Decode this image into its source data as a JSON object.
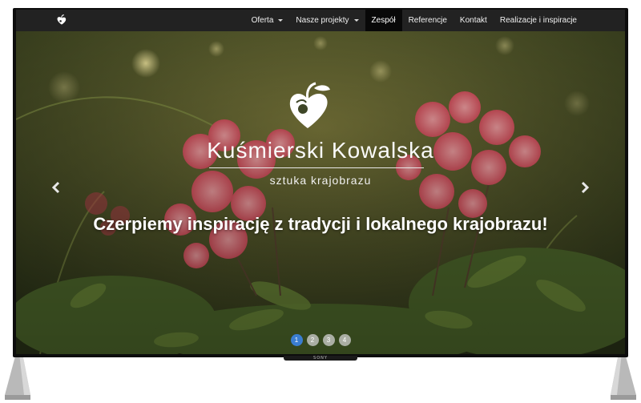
{
  "navbar": {
    "brand_icon": "heart-fruit-logo-icon",
    "items": [
      {
        "label": "Oferta",
        "dropdown": true
      },
      {
        "label": "Nasze projekty",
        "dropdown": true
      },
      {
        "label": "Zespół",
        "active": true
      },
      {
        "label": "Referencje"
      },
      {
        "label": "Kontakt"
      },
      {
        "label": "Realizacje i inspiracje"
      }
    ]
  },
  "hero": {
    "logo_icon": "heart-fruit-logo-icon",
    "title": "Kuśmierski Kowalska",
    "subtitle": "sztuka krajobrazu",
    "tagline": "Czerpiemy inspirację z tradycji i lokalnego krajobrazu!",
    "prev_icon": "chevron-left-icon",
    "next_icon": "chevron-right-icon",
    "indicators": [
      "1",
      "2",
      "3",
      "4"
    ],
    "active_indicator": 1
  },
  "device": {
    "brand": "SONY"
  },
  "colors": {
    "navbar": "#222222",
    "active_nav": "#080808",
    "indicator_active": "#3a7dd0",
    "flower": "#e8707a",
    "foliage": "#4f6a2c"
  }
}
